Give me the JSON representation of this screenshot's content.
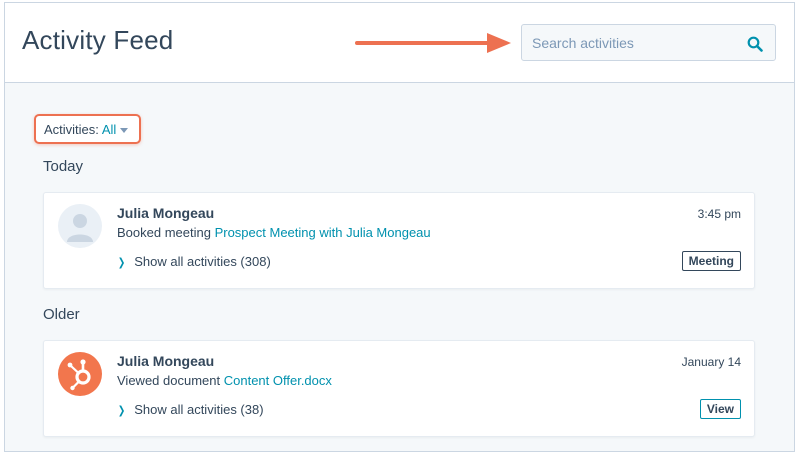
{
  "header": {
    "title": "Activity Feed",
    "search": {
      "placeholder": "Search activities",
      "value": ""
    }
  },
  "filter": {
    "label": "Activities:",
    "value": "All"
  },
  "sections": [
    {
      "heading": "Today",
      "card": {
        "name": "Julia Mongeau",
        "time": "3:45 pm",
        "action": "Booked meeting",
        "link": "Prospect Meeting with Julia Mongeau",
        "show_all": "Show all activities (308)",
        "button": "Meeting",
        "avatar": "default-user-icon"
      }
    },
    {
      "heading": "Older",
      "card": {
        "name": "Julia Mongeau",
        "time": "January 14",
        "action": "Viewed document",
        "link": "Content Offer.docx",
        "show_all": "Show all activities (38)",
        "button": "View",
        "avatar": "hubspot-sprocket-icon"
      }
    }
  ],
  "colors": {
    "accent": "#0091ae",
    "annotation": "#ed7151",
    "text": "#33475b",
    "placeholder": "#7c98b6",
    "background": "#f5f8fa",
    "hubspot_orange": "#f2764d"
  },
  "icons": {
    "search": "search-icon",
    "caret": "caret-down-icon",
    "chevron": "chevron-right-icon",
    "annotation_arrow": "arrow-right-icon"
  }
}
